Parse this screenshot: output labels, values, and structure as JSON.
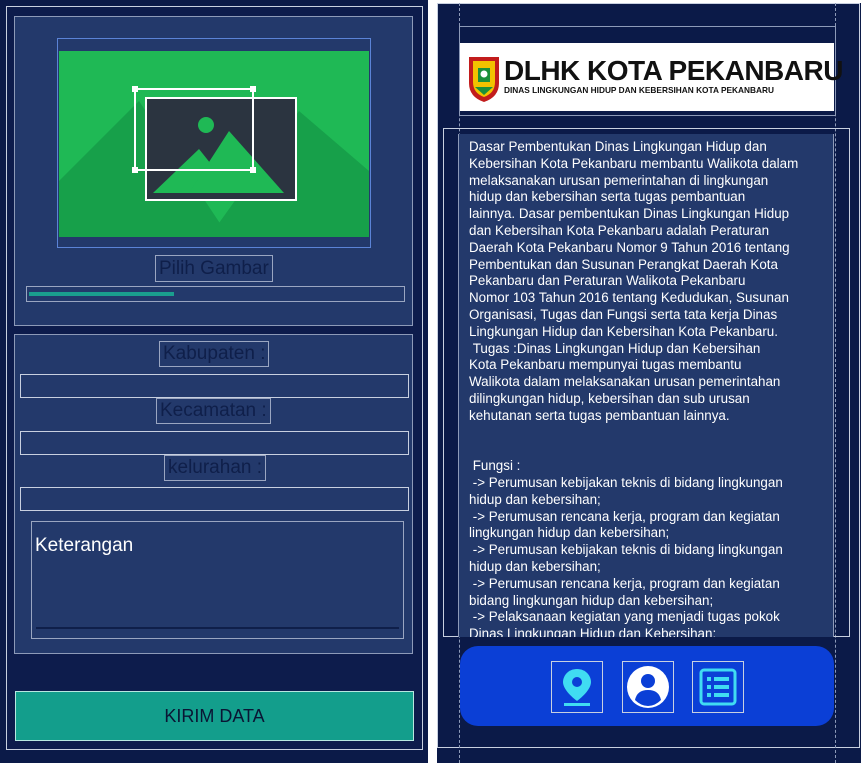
{
  "left_screen": {
    "image_picker": {
      "pick_label": "Pilih Gambar",
      "upload_progress": 0.39
    },
    "form": {
      "kabupaten_label": "Kabupaten :",
      "kabupaten_value": "",
      "kecamatan_label": "Kecamatan :",
      "kecamatan_value": "",
      "kelurahan_label": "kelurahan :",
      "kelurahan_value": "",
      "keterangan_placeholder": "Keterangan"
    },
    "submit_label": "KIRIM DATA"
  },
  "right_screen": {
    "logo": {
      "title": "DLHK KOTA PEKANBARU",
      "subtitle": "DINAS LINGKUNGAN HIDUP DAN KEBERSIHAN KOTA PEKANBARU"
    },
    "article": "Dasar Pembentukan Dinas Lingkungan Hidup dan\nKebersihan Kota Pekanbaru membantu Walikota dalam\nmelaksanakan urusan pemerintahan di lingkungan\nhidup dan kebersihan serta tugas pembantuan\nlainnya. Dasar pembentukan Dinas Lingkungan Hidup\ndan Kebersihan Kota Pekanbaru adalah Peraturan\nDaerah Kota Pekanbaru Nomor 9 Tahun 2016 tentang\nPembentukan dan Susunan Perangkat Daerah Kota\nPekanbaru dan Peraturan Walikota Pekanbaru\nNomor 103 Tahun 2016 tentang Kedudukan, Susunan\nOrganisasi, Tugas dan Fungsi serta tata kerja Dinas\nLingkungan Hidup dan Kebersihan Kota Pekanbaru.\n Tugas :Dinas Lingkungan Hidup dan Kebersihan\nKota Pekanbaru mempunyai tugas membantu\nWalikota dalam melaksanakan urusan pemerintahan\ndilingkungan hidup, kebersihan dan sub urusan\nkehutanan serta tugas pembantuan lainnya.\n\n\n Fungsi :\n -> Perumusan kebijakan teknis di bidang lingkungan\nhidup dan kebersihan;\n -> Perumusan rencana kerja, program dan kegiatan\nlingkungan hidup dan kebersihan;\n -> Perumusan kebijakan teknis di bidang lingkungan\nhidup dan kebersihan;\n -> Perumusan rencana kerja, program dan kegiatan\nbidang lingkungan hidup dan kebersihan;\n -> Pelaksanaan kegiatan yang menjadi tugas pokok\nDinas Lingkungan Hidup dan Kebersihan;",
    "nav": [
      {
        "icon": "location-pin-icon"
      },
      {
        "icon": "user-profile-icon"
      },
      {
        "icon": "list-icon"
      }
    ],
    "colors": {
      "background": "#0b1a48",
      "card": "#23396b",
      "accent_teal": "#139e8c",
      "nav_blue": "#0b3fd6",
      "icon_cyan": "#40dcf2"
    }
  }
}
